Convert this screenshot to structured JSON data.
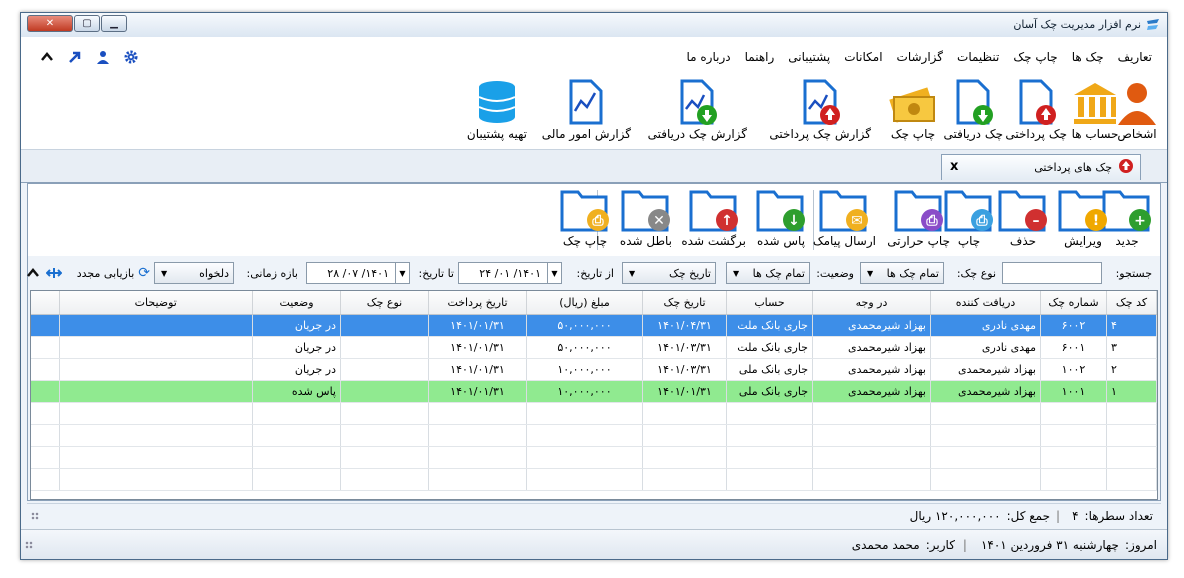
{
  "window": {
    "title": "نرم افزار مدیریت چک آسان"
  },
  "menu": [
    "تعاریف",
    "چک ها",
    "چاپ چک",
    "تنظیمات",
    "گزارشات",
    "امکانات",
    "پشتیبانی",
    "راهنما",
    "درباره ما"
  ],
  "ribbon": [
    {
      "label": "اشخاص",
      "icon": "person-icon"
    },
    {
      "label": "حساب ها",
      "icon": "bank-icon"
    },
    {
      "label": "چک پرداختی",
      "icon": "doc-up-icon"
    },
    {
      "label": "چک دریافتی",
      "icon": "doc-down-icon"
    },
    {
      "label": "چاپ چک",
      "icon": "money-icon"
    },
    {
      "label": "گزارش چک پرداختی",
      "icon": "report-up-icon"
    },
    {
      "label": "گزارش چک دریافتی",
      "icon": "report-down-icon"
    },
    {
      "label": "گزارش امور مالی",
      "icon": "report-icon"
    },
    {
      "label": "تهیه پشتیبان",
      "icon": "database-icon"
    }
  ],
  "tab": {
    "label": "چک های پرداختی",
    "close": "x"
  },
  "toolbar": [
    {
      "label": "جدید",
      "badge": "+",
      "color": "#2e9e2e"
    },
    {
      "label": "ویرایش",
      "badge": "!",
      "color": "#f0a800"
    },
    {
      "label": "حذف",
      "badge": "–",
      "color": "#d03030"
    },
    {
      "label": "چاپ",
      "badge": "⎙",
      "color": "#3aa0e0"
    },
    {
      "label": "چاپ حرارتی",
      "badge": "⎙",
      "color": "#8a4cc8"
    },
    {
      "label": "ارسال پیامک",
      "badge": "✉",
      "color": "#f0b020"
    },
    {
      "label": "پاس شده",
      "badge": "↓",
      "color": "#2e9e2e"
    },
    {
      "label": "برگشت شده",
      "badge": "↑",
      "color": "#d03030"
    },
    {
      "label": "باطل شده",
      "badge": "✕",
      "color": "#888888"
    },
    {
      "label": "چاپ چک",
      "badge": "⎙",
      "color": "#f0b020"
    }
  ],
  "filter": {
    "search_label": "جستجو:",
    "type_label": "نوع چک:",
    "type_value": "تمام چک ها",
    "status_label": "وضعیت:",
    "status_value": "تمام چک ها",
    "datefield_value": "تاریخ چک",
    "from_label": "از تاریخ:",
    "from_value": "۱۴۰۱/ ۰۱/ ۲۴",
    "to_label": "تا تاریخ:",
    "to_value": "۱۴۰۱/ ۰۷/ ۲۸",
    "range_label": "بازه زمانی:",
    "range_value": "دلخواه",
    "refresh_label": "بازیابی مجدد"
  },
  "table": {
    "headers": [
      "کد چک",
      "شماره چک",
      "دریافت کننده",
      "در وجه",
      "حساب",
      "تاریخ چک",
      "مبلغ (ریال)",
      "تاریخ پرداخت",
      "نوع چک",
      "وضعیت",
      "توضیحات"
    ],
    "rows": [
      {
        "cells": [
          "۴",
          "۶۰۰۲",
          "مهدی نادری",
          "بهزاد شیرمحمدی",
          "جاری بانک ملت",
          "۱۴۰۱/۰۴/۳۱",
          "۵۰,۰۰۰,۰۰۰",
          "۱۴۰۱/۰۱/۳۱",
          "",
          "در جریان",
          ""
        ],
        "style": "sel"
      },
      {
        "cells": [
          "۳",
          "۶۰۰۱",
          "مهدی نادری",
          "بهزاد شیرمحمدی",
          "جاری بانک ملت",
          "۱۴۰۱/۰۳/۳۱",
          "۵۰,۰۰۰,۰۰۰",
          "۱۴۰۱/۰۱/۳۱",
          "",
          "در جریان",
          ""
        ],
        "style": ""
      },
      {
        "cells": [
          "۲",
          "۱۰۰۲",
          "بهزاد شیرمحمدی",
          "بهزاد شیرمحمدی",
          "جاری بانک ملی",
          "۱۴۰۱/۰۳/۳۱",
          "۱۰,۰۰۰,۰۰۰",
          "۱۴۰۱/۰۱/۳۱",
          "",
          "در جریان",
          ""
        ],
        "style": ""
      },
      {
        "cells": [
          "۱",
          "۱۰۰۱",
          "بهزاد شیرمحمدی",
          "بهزاد شیرمحمدی",
          "جاری بانک ملی",
          "۱۴۰۱/۰۱/۳۱",
          "۱۰,۰۰۰,۰۰۰",
          "۱۴۰۱/۰۱/۳۱",
          "",
          "پاس شده",
          ""
        ],
        "style": "green"
      }
    ]
  },
  "summary": {
    "rows_label": "تعداد سطرها:",
    "rows_value": "۴",
    "total_label": "جمع کل:",
    "total_value": "۱۲۰,۰۰۰,۰۰۰ ریال"
  },
  "status": {
    "today_label": "امروز:",
    "today_value": "چهارشنبه ۳۱ فروردین ۱۴۰۱",
    "user_label": "کاربر:",
    "user_value": "محمد محمدی"
  }
}
